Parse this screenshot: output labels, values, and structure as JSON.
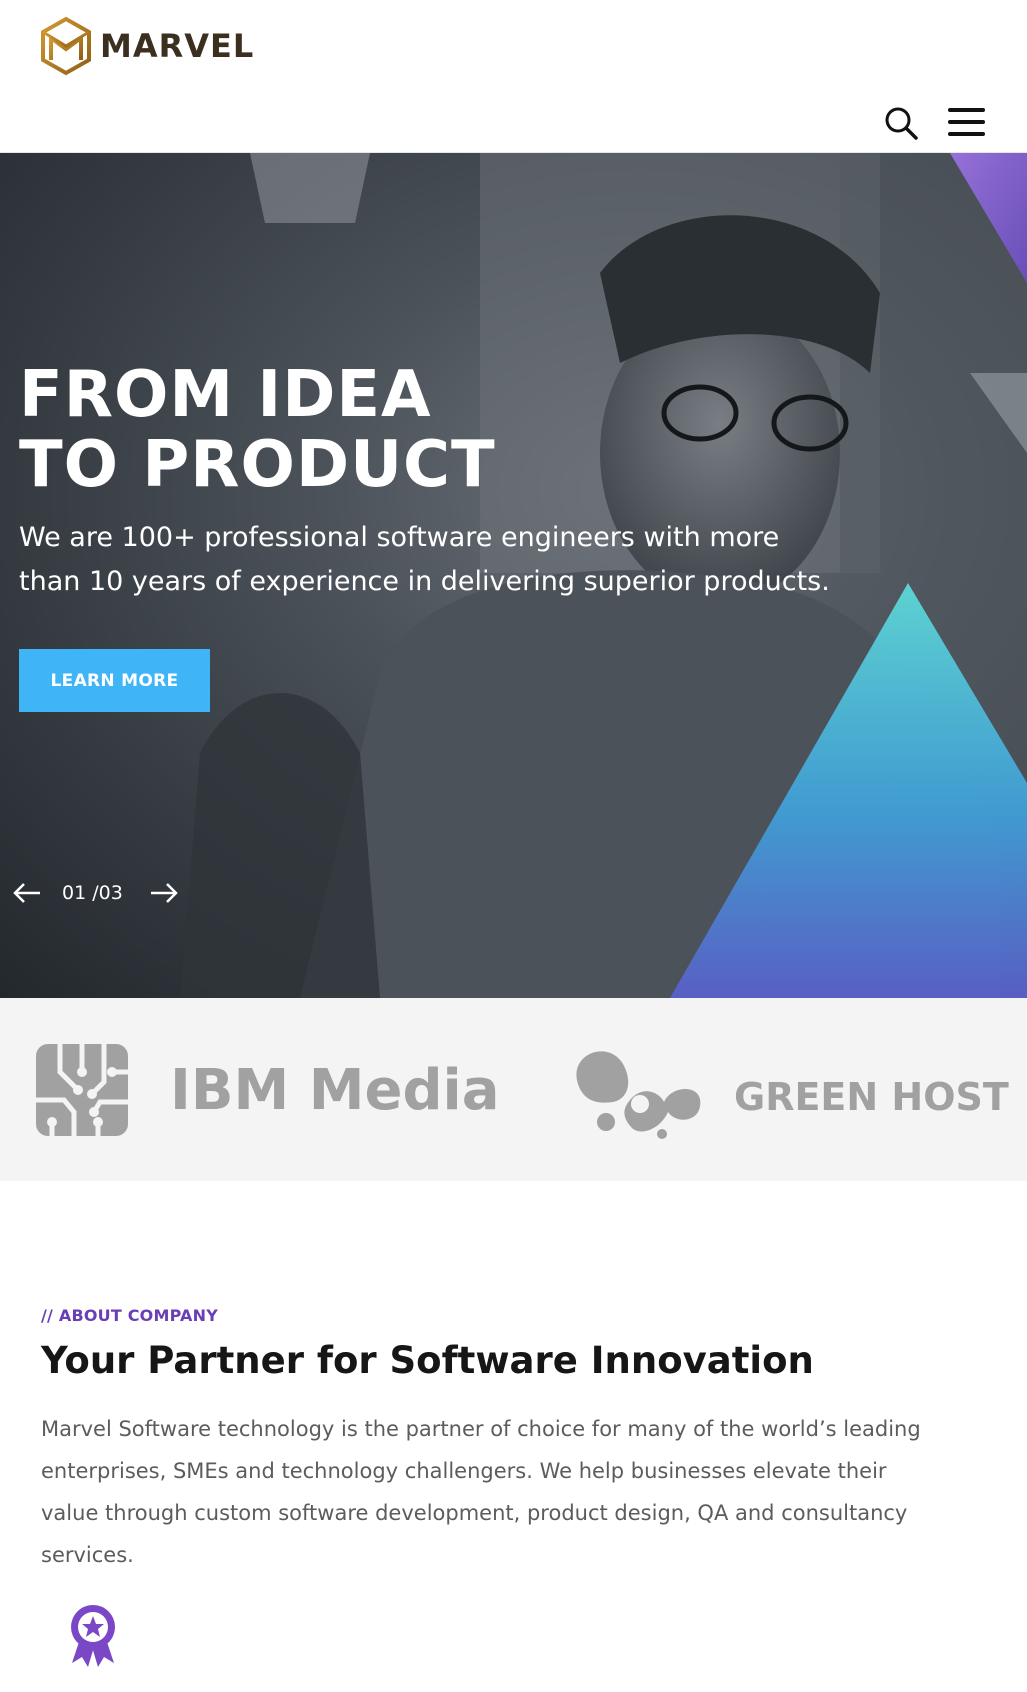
{
  "header": {
    "brand": "MARVEL",
    "search_label": "Search",
    "menu_label": "Menu"
  },
  "hero": {
    "title_line1": "FROM IDEA",
    "title_line2": "TO PRODUCT",
    "subtitle": "We are 100+ professional software engineers with more than 10 years of experience in delivering superior products.",
    "cta_label": "LEARN MORE",
    "slide_current": "01",
    "slide_total": "/03"
  },
  "partners": {
    "items": [
      {
        "name": "IBM Media",
        "icon": "circuit-chip-icon"
      },
      {
        "name": "GREEN HOST",
        "icon": "blob-dots-icon"
      }
    ]
  },
  "about": {
    "tag": "// ABOUT COMPANY",
    "title": "Your Partner for Software Innovation",
    "body": "Marvel Software technology is the partner of choice for many of the world’s leading enterprises, SMEs and technology challengers. We help businesses elevate their value through custom software development, product design, QA and consultancy services.",
    "icon": "award-ribbon-icon"
  },
  "colors": {
    "accent_blue": "#3fb4f6",
    "accent_purple": "#6a3fb5",
    "logo_gold": "#c08a2b",
    "partner_gray": "#a1a1a1"
  }
}
